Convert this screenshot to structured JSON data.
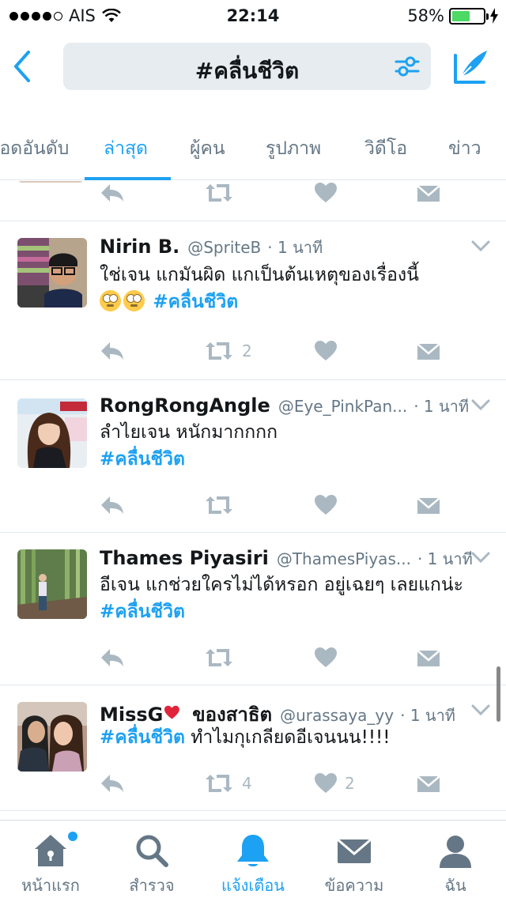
{
  "status_bar": {
    "carrier": "AIS",
    "time": "22:14",
    "battery_percent": "58%",
    "battery_level": 0.58,
    "signal_bars": 4
  },
  "nav": {
    "search_query": "#คลื่นชีวิต",
    "back_icon": "chevron-left-icon",
    "filter_icon": "sliders-icon",
    "compose_icon": "compose-icon"
  },
  "tabs": [
    {
      "label": "ยอดอันดับ",
      "active": false
    },
    {
      "label": "ล่าสุด",
      "active": true
    },
    {
      "label": "ผู้คน",
      "active": false
    },
    {
      "label": "รูปภาพ",
      "active": false
    },
    {
      "label": "วิดีโอ",
      "active": false
    },
    {
      "label": "ข่าว",
      "active": false
    }
  ],
  "tweets": [
    {
      "name": "Nirin B.",
      "handle": "@SpriteB",
      "time": "· 1 นาที",
      "text_line1": "ใช่เจน แกมันผิด แกเป็นต้นเหตุของเรื่องนี้",
      "emoji": "🙄🙄",
      "hashtag": "#คลื่นชีวิต",
      "retweets": "2",
      "likes": ""
    },
    {
      "name": "RongRongAngle",
      "handle": "@Eye_PinkPan...",
      "time": "· 1 นาที",
      "text_line1": "ลำไยเจน หนักมากกกก",
      "hashtag": "#คลื่นชีวิต",
      "retweets": "",
      "likes": ""
    },
    {
      "name": "Thames Piyasiri",
      "handle": "@ThamesPiyas...",
      "time": "· 1 นาที",
      "text_line1": "อีเจน แกช่วยใครไม่ได้หรอก อยู่เฉยๆ เลยแกน่ะ",
      "hashtag": "#คลื่นชีวิต",
      "retweets": "",
      "likes": ""
    },
    {
      "name": "MissG",
      "name_suffix": "ของสาธิต",
      "handle": "@urassaya_yy",
      "time": "· 1 นาที",
      "hashtag": "#คลื่นชีวิต",
      "text_after": "ทำไมกุเกลียดอีเจนนน!!!!",
      "retweets": "4",
      "likes": "2"
    }
  ],
  "tab_bar": [
    {
      "label": "หน้าแรก",
      "icon": "home-icon",
      "active": false
    },
    {
      "label": "สำรวจ",
      "icon": "search-icon",
      "active": false
    },
    {
      "label": "แจ้งเตือน",
      "icon": "bell-icon",
      "active": true
    },
    {
      "label": "ข้อความ",
      "icon": "envelope-icon",
      "active": false
    },
    {
      "label": "ฉัน",
      "icon": "person-icon",
      "active": false
    }
  ],
  "colors": {
    "accent": "#1da1f2",
    "secondary_text": "#657786",
    "action_gray": "#aab8c2",
    "battery_green": "#4cd964"
  }
}
